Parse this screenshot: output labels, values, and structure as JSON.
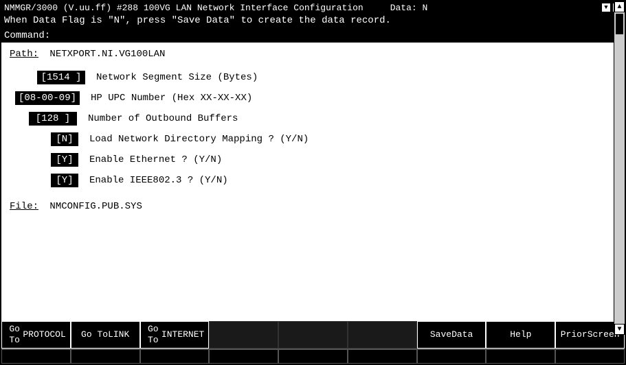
{
  "window": {
    "title": "NMMGR/3000 (V.uu.ff) #288 100VG LAN Network Interface Configuration",
    "data_flag_message": "When Data Flag is \"N\", press \"Save Data\" to create the data record.",
    "command_label": "Command:",
    "data_indicator": "Data: N"
  },
  "path": {
    "label": "Path:",
    "value": "NETXPORT.NI.VG100LAN"
  },
  "fields": [
    {
      "value": "1514",
      "label": "Network Segment Size (Bytes)",
      "display": "[1514 ]"
    },
    {
      "value": "08-00-09",
      "label": "HP UPC Number (Hex XX-XX-XX)",
      "display": "[08-00-09]"
    },
    {
      "value": "128",
      "label": "Number of Outbound Buffers",
      "display": "[128 ]"
    },
    {
      "value": "N",
      "label": "Load Network Directory Mapping ? (Y/N)",
      "display": "[N]"
    },
    {
      "value": "Y",
      "label": "Enable Ethernet ? (Y/N)",
      "display": "[Y]"
    },
    {
      "value": "Y",
      "label": "Enable IEEE802.3 ? (Y/N)",
      "display": "[Y]"
    }
  ],
  "file": {
    "label": "File:",
    "value": "NMCONFIG.PUB.SYS"
  },
  "buttons": {
    "btn1_line1": "Go To",
    "btn1_line2": "PROTOCOL",
    "btn2_line1": "Go To",
    "btn2_line2": "LINK",
    "btn3_line1": "Go To",
    "btn3_line2": "INTERNET",
    "btn4_line1": "",
    "btn4_line2": "",
    "btn5_line1": "",
    "btn5_line2": "",
    "btn6_line1": "",
    "btn6_line2": "",
    "btn7_line1": "Save",
    "btn7_line2": "Data",
    "btn8_line1": "Help",
    "btn8_line2": "",
    "btn9_line1": "Prior",
    "btn9_line2": "Screen"
  },
  "scrollbar": {
    "up_arrow": "▲",
    "down_arrow": "▼"
  }
}
